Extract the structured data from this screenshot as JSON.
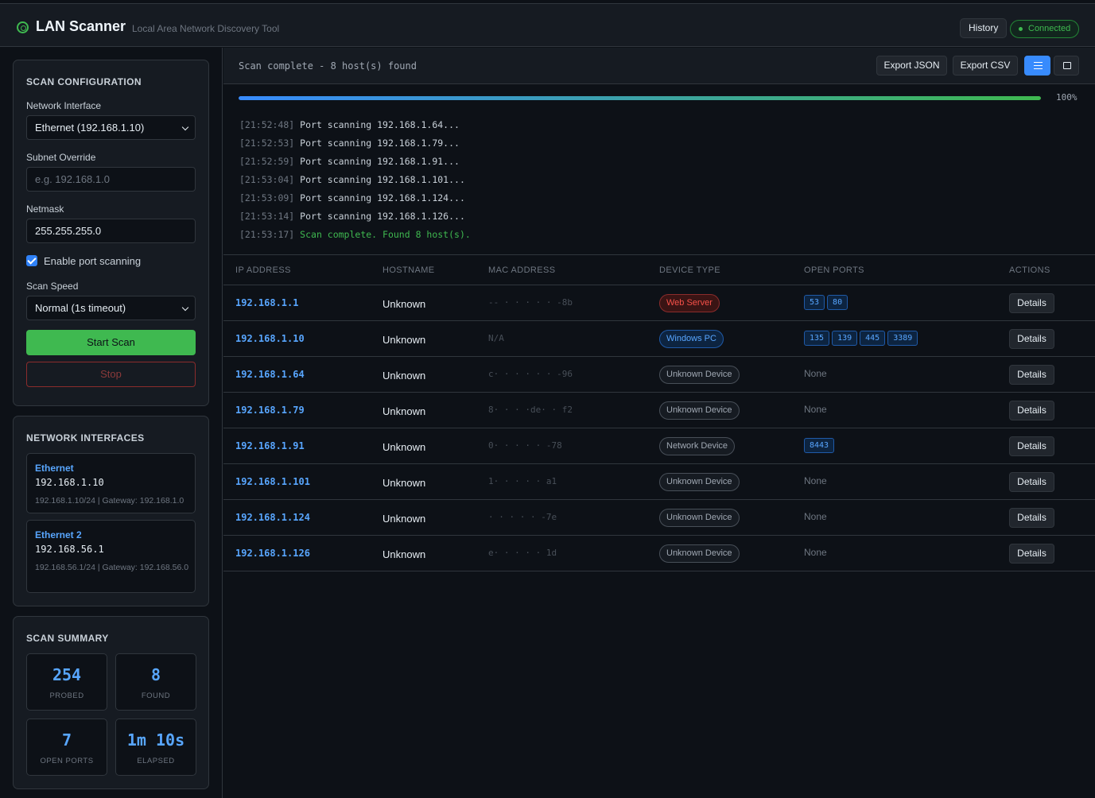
{
  "header": {
    "title": "LAN Scanner",
    "subtitle": "Local Area Network Discovery Tool",
    "history_label": "History",
    "connection_status": "Connected"
  },
  "scan_config": {
    "title": "SCAN CONFIGURATION",
    "interface_label": "Network Interface",
    "interface_value": "Ethernet (192.168.1.10)",
    "subnet_label": "Subnet Override",
    "subnet_placeholder": "e.g. 192.168.1.0",
    "netmask_label": "Netmask",
    "netmask_value": "255.255.255.0",
    "port_scan_label": "Enable port scanning",
    "port_scan_checked": true,
    "speed_label": "Scan Speed",
    "speed_value": "Normal (1s timeout)",
    "start_label": "Start Scan",
    "stop_label": "Stop"
  },
  "interfaces": {
    "title": "NETWORK INTERFACES",
    "items": [
      {
        "name": "Ethernet",
        "ip": "192.168.1.10",
        "detail": "192.168.1.10/24 | Gateway: 192.168.1.0"
      },
      {
        "name": "Ethernet 2",
        "ip": "192.168.56.1",
        "detail": "192.168.56.1/24 | Gateway: 192.168.56.0"
      }
    ]
  },
  "summary": {
    "title": "SCAN SUMMARY",
    "probed_value": "254",
    "probed_label": "PROBED",
    "found_value": "8",
    "found_label": "FOUND",
    "ports_value": "7",
    "ports_label": "OPEN PORTS",
    "elapsed_value": "1m 10s",
    "elapsed_label": "ELAPSED"
  },
  "status": {
    "text": "Scan complete - 8 host(s) found",
    "export_json": "Export JSON",
    "export_csv": "Export CSV",
    "progress_percent": 100,
    "progress_label": "100%"
  },
  "log": [
    {
      "time": "[21:52:48]",
      "msg": "Port scanning 192.168.1.64...",
      "ok": false
    },
    {
      "time": "[21:52:53]",
      "msg": "Port scanning 192.168.1.79...",
      "ok": false
    },
    {
      "time": "[21:52:59]",
      "msg": "Port scanning 192.168.1.91...",
      "ok": false
    },
    {
      "time": "[21:53:04]",
      "msg": "Port scanning 192.168.1.101...",
      "ok": false
    },
    {
      "time": "[21:53:09]",
      "msg": "Port scanning 192.168.1.124...",
      "ok": false
    },
    {
      "time": "[21:53:14]",
      "msg": "Port scanning 192.168.1.126...",
      "ok": false
    },
    {
      "time": "[21:53:17]",
      "msg": "Scan complete. Found 8 host(s).",
      "ok": true
    }
  ],
  "table": {
    "headers": [
      "IP ADDRESS",
      "HOSTNAME",
      "MAC ADDRESS",
      "DEVICE TYPE",
      "OPEN PORTS",
      "ACTIONS"
    ],
    "details_label": "Details",
    "none_label": "None",
    "rows": [
      {
        "ip": "192.168.1.1",
        "hostname": "Unknown",
        "mac": "-- ·  ·  ·  ·  · -8b",
        "type": "Web Server",
        "type_class": "web",
        "ports": [
          "53",
          "80"
        ]
      },
      {
        "ip": "192.168.1.10",
        "hostname": "Unknown",
        "mac": "N/A",
        "type": "Windows PC",
        "type_class": "win",
        "ports": [
          "135",
          "139",
          "445",
          "3389"
        ]
      },
      {
        "ip": "192.168.1.64",
        "hostname": "Unknown",
        "mac": "c·  ·  ·  ·  ·  · -96",
        "type": "Unknown Device",
        "type_class": "unk",
        "ports": []
      },
      {
        "ip": "192.168.1.79",
        "hostname": "Unknown",
        "mac": "8·  ·  · ·de·  · f2",
        "type": "Unknown Device",
        "type_class": "unk",
        "ports": []
      },
      {
        "ip": "192.168.1.91",
        "hostname": "Unknown",
        "mac": "0·  ·  ·  ·  · -78",
        "type": "Network Device",
        "type_class": "unk",
        "ports": [
          "8443"
        ]
      },
      {
        "ip": "192.168.1.101",
        "hostname": "Unknown",
        "mac": "1·  ·  ·  ·  · a1",
        "type": "Unknown Device",
        "type_class": "unk",
        "ports": []
      },
      {
        "ip": "192.168.1.124",
        "hostname": "Unknown",
        "mac": "·  ·  ·  ·  · -7e",
        "type": "Unknown Device",
        "type_class": "unk",
        "ports": []
      },
      {
        "ip": "192.168.1.126",
        "hostname": "Unknown",
        "mac": "e·  ·  ·  ·  · 1d",
        "type": "Unknown Device",
        "type_class": "unk",
        "ports": []
      }
    ]
  }
}
